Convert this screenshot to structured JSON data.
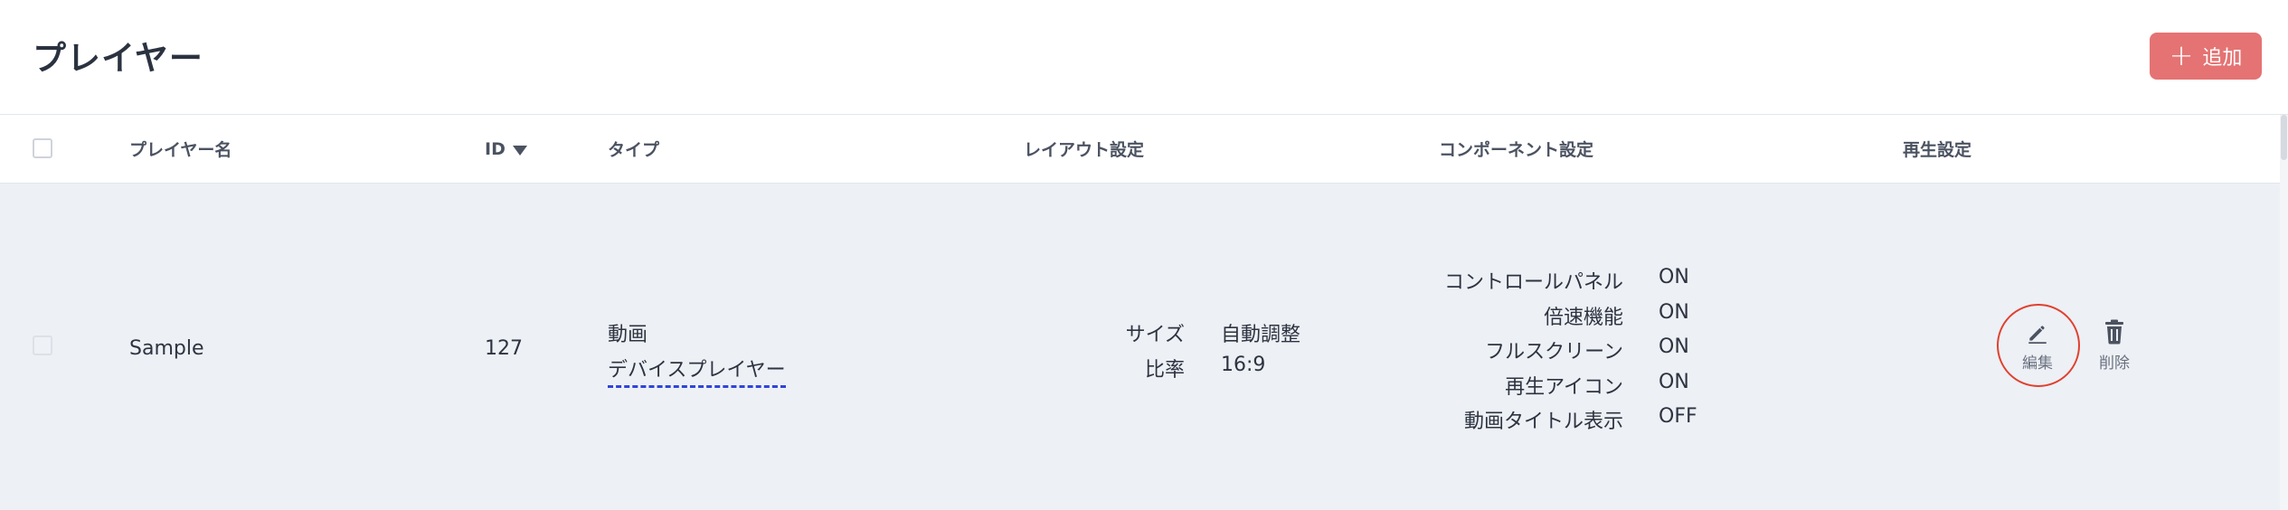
{
  "header": {
    "title": "プレイヤー",
    "add_button_label": "追加"
  },
  "table": {
    "columns": {
      "name": "プレイヤー名",
      "id": "ID",
      "type": "タイプ",
      "layout": "レイアウト設定",
      "component": "コンポーネント設定",
      "playback": "再生設定"
    },
    "sort": {
      "column": "ID",
      "direction": "descending"
    },
    "rows": [
      {
        "name": "Sample",
        "id": "127",
        "type_main": "動画",
        "type_sub": "デバイスプレイヤー",
        "layout": [
          {
            "key": "サイズ",
            "value": "自動調整"
          },
          {
            "key": "比率",
            "value": "16:9"
          }
        ],
        "components": [
          {
            "key": "コントロールパネル",
            "value": "ON"
          },
          {
            "key": "倍速機能",
            "value": "ON"
          },
          {
            "key": "フルスクリーン",
            "value": "ON"
          },
          {
            "key": "再生アイコン",
            "value": "ON"
          },
          {
            "key": "動画タイトル表示",
            "value": "OFF"
          }
        ],
        "actions": {
          "edit_label": "編集",
          "delete_label": "削除"
        }
      }
    ]
  },
  "colors": {
    "accent": "#e57373",
    "row_background": "#edf0f5",
    "link_underline": "#2f45d8",
    "highlight_circle": "#e0412f"
  },
  "icons": [
    "plus-icon",
    "sort-down-icon",
    "pencil-icon",
    "trash-icon"
  ]
}
